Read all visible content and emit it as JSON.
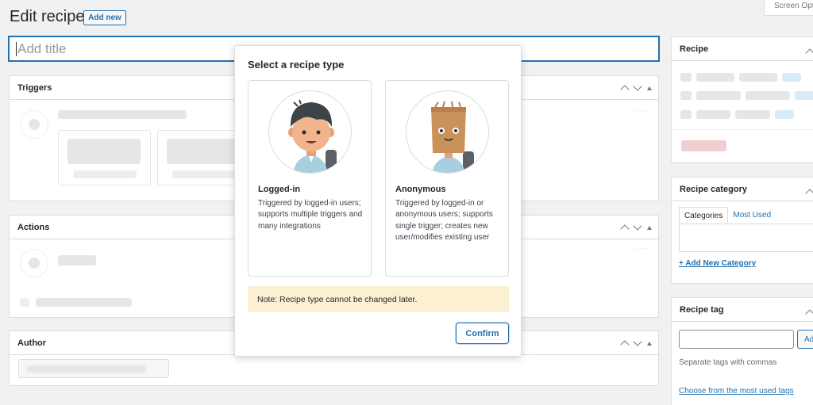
{
  "header": {
    "page_title": "Edit recipe",
    "add_new_label": "Add new",
    "screen_options_label": "Screen Opt"
  },
  "title_field": {
    "placeholder": "Add title",
    "value": ""
  },
  "panels": {
    "triggers": {
      "title": "Triggers"
    },
    "actions": {
      "title": "Actions"
    },
    "author": {
      "title": "Author"
    }
  },
  "sidebar": {
    "recipe": {
      "title": "Recipe"
    },
    "category": {
      "title": "Recipe category",
      "tabs": [
        "Categories",
        "Most Used"
      ],
      "add_link": "+ Add New Category"
    },
    "tag": {
      "title": "Recipe tag",
      "add_button": "Ad",
      "help": "Separate tags with commas",
      "choose_link": "Choose from the most used tags"
    }
  },
  "modal": {
    "title": "Select a recipe type",
    "options": [
      {
        "name": "Logged-in",
        "description": "Triggered by logged-in users; supports multiple triggers and many integrations",
        "icon": "logged-in-user-avatar"
      },
      {
        "name": "Anonymous",
        "description": "Triggered by logged-in or anonymous users; supports single trigger; creates new user/modifies existing user",
        "icon": "paper-bag-avatar"
      }
    ],
    "note": "Note: Recipe type cannot be changed later.",
    "confirm_label": "Confirm"
  },
  "colors": {
    "accent": "#2271b1",
    "note_background": "#fcf0d3",
    "page_background": "#f1f1f1"
  }
}
